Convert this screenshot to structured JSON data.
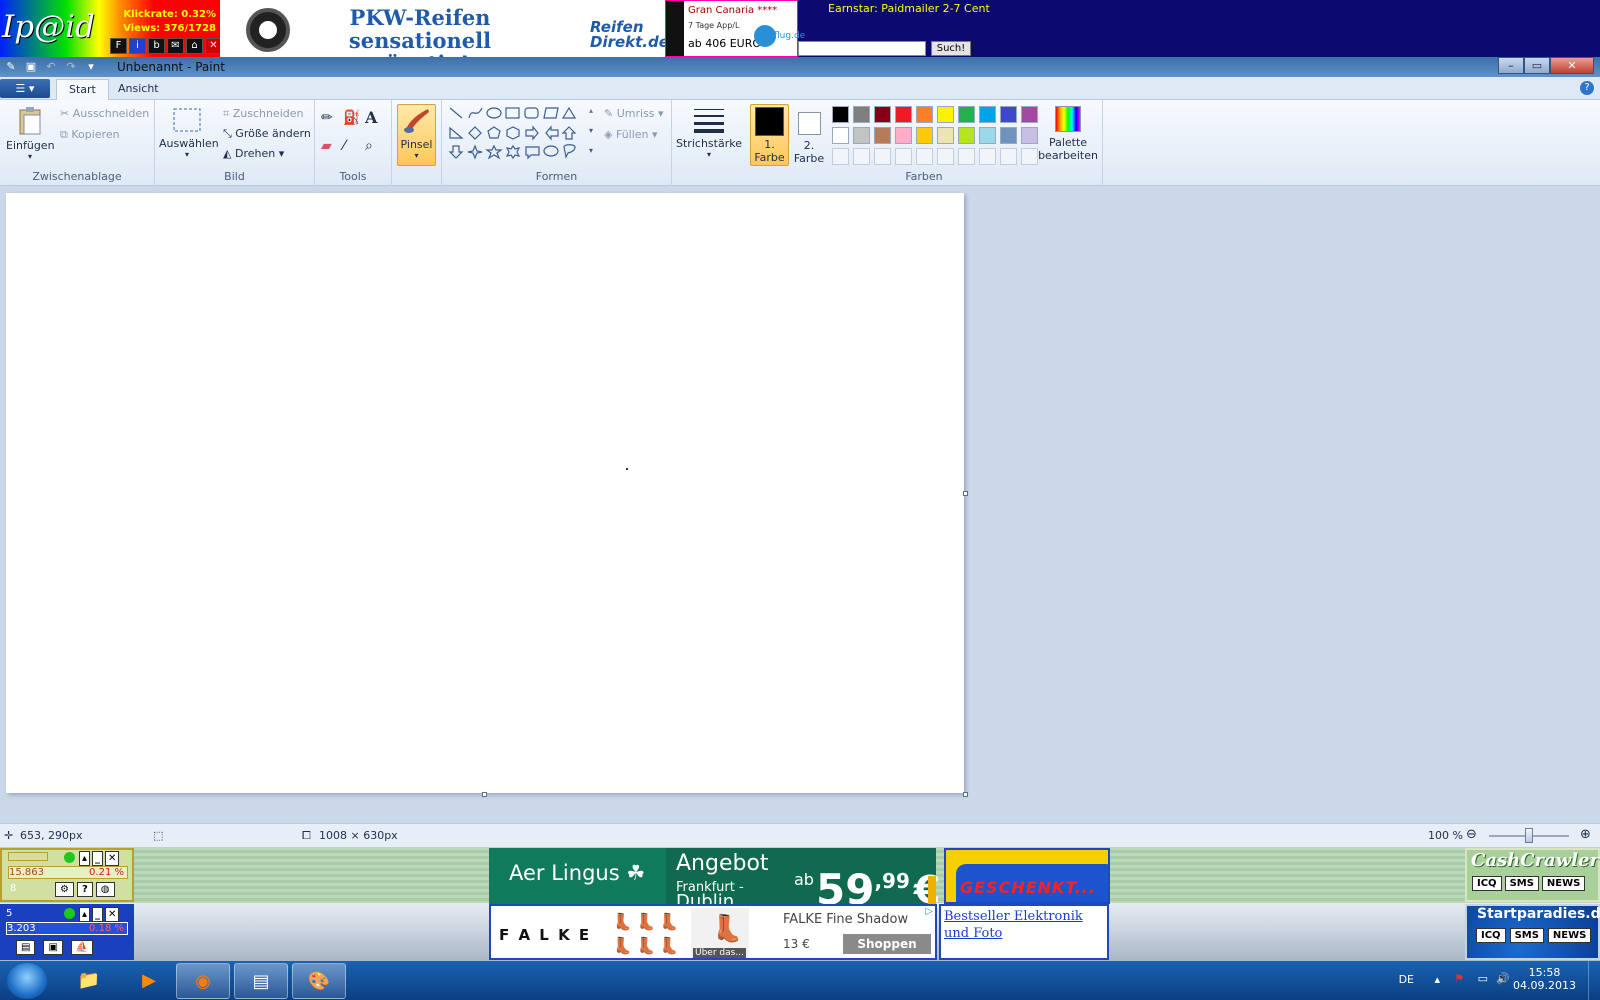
{
  "ads_top": {
    "ipaid_logo": "Ip@id",
    "klickrate": "Klickrate: 0.32%",
    "views": "Views: 376/1728",
    "ipaid_icons": [
      "F",
      "i",
      "b",
      "✉",
      "⌂",
      "✕"
    ],
    "reifen_headline_1": "PKW-Reifen",
    "reifen_headline_2": "sensationell günstig!",
    "reifen_brand_1": "Reifen",
    "reifen_brand_2": "Direkt.de",
    "flug_destination": "Gran Canaria ****",
    "flug_detail": "7 Tage App/L",
    "flug_price": "ab 406 EURO »",
    "flug_brand": "flug.de",
    "earnstar": "Earnstar: Paidmailer 2-7 Cent",
    "search_value": "",
    "search_button": "Such!"
  },
  "window": {
    "title": "Unbenannt - Paint",
    "controls": [
      "–",
      "▭",
      "✕"
    ]
  },
  "ribbon": {
    "tabs": [
      "Start",
      "Ansicht"
    ],
    "help": "?",
    "groups": {
      "clipboard": {
        "label": "Zwischenablage",
        "paste": "Einfügen",
        "cut": "Ausschneiden",
        "copy": "Kopieren"
      },
      "image": {
        "label": "Bild",
        "select": "Auswählen",
        "crop": "Zuschneiden",
        "resize": "Größe ändern",
        "rotate": "Drehen"
      },
      "tools": {
        "label": "Tools"
      },
      "brushes": {
        "label": "Pinsel"
      },
      "shapes": {
        "label": "Formen",
        "outline": "Umriss",
        "fill": "Füllen"
      },
      "size": {
        "label": "Strichstärke"
      },
      "colors": {
        "label": "Farben",
        "color1_line1": "1.",
        "color1_line2": "Farbe",
        "color2_line1": "2.",
        "color2_line2": "Farbe",
        "edit_line1": "Palette",
        "edit_line2": "bearbeiten",
        "color1": "#000000",
        "color2": "#ffffff",
        "palette_row1": [
          "#000000",
          "#7f7f7f",
          "#880015",
          "#ed1c24",
          "#ff7f27",
          "#fff200",
          "#22b14c",
          "#00a2e8",
          "#3f48cc",
          "#a349a4"
        ],
        "palette_row2": [
          "#ffffff",
          "#c3c3c3",
          "#b97a57",
          "#ffaec9",
          "#ffc90e",
          "#efe4b0",
          "#b5e61d",
          "#99d9ea",
          "#7092be",
          "#c8bfe7"
        ]
      }
    }
  },
  "statusbar": {
    "cursor_pos": "653, 290px",
    "image_size": "1008 × 630px",
    "zoom": "100 %",
    "zoom_level": 0.5
  },
  "ads_bottom": {
    "w1_value": "15.863",
    "w1_percent": "0.21 %",
    "w1_num": "8",
    "w2_num": "5",
    "w2_value": "3.203",
    "w2_percent": "0.18 %",
    "aer_lingus": "Aer Lingus ☘",
    "angebot": "Angebot",
    "angebot_route": "Frankfurt -",
    "angebot_route2": "Dublin",
    "angebot_ab": "ab",
    "angebot_price": "59",
    "angebot_cents": ",99",
    "angebot_eur": "€",
    "geschenkt": "GESCHENKT...",
    "cashcrawler": "CashCrawler",
    "cash_buttons": [
      "ICQ",
      "SMS",
      "NEWS"
    ],
    "falke_brand": "F A L K E",
    "falke_product": "FALKE Fine Shadow",
    "falke_price": "13 €",
    "falke_button": "Shoppen",
    "falke_caption": "Über das...",
    "bestseller": "Bestseller Elektronik und Foto",
    "startparadies": "Startparadies.de",
    "start_buttons": [
      "ICQ",
      "SMS",
      "NEWS"
    ]
  },
  "taskbar": {
    "lang": "DE",
    "time": "15:58",
    "date": "04.09.2013"
  }
}
